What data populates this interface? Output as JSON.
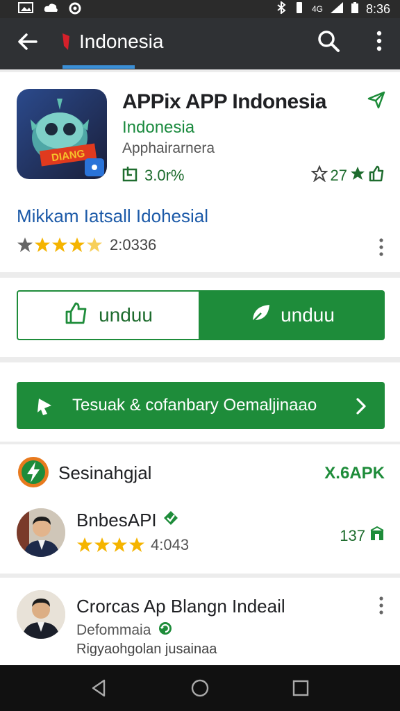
{
  "status_bar": {
    "time": "8:36",
    "carrier": "4G"
  },
  "app_bar": {
    "title": "Indonesia"
  },
  "app": {
    "name": "APPix APP Indonesia",
    "developer": "Indonesia",
    "category": "Apphairarnera",
    "downloads": "3.0r%",
    "rating_badge": "27",
    "icon_banner": "DIANG"
  },
  "promo": {
    "link": "Mikkam Iatsall Idohesial",
    "stars": 4,
    "count": "2:0336"
  },
  "buttons": {
    "outline_label": "unduu",
    "fill_label": "unduu"
  },
  "cta": {
    "label": "Tesuak & cofanbary Oemaljinaao"
  },
  "list": {
    "title": "Sesinahgjal",
    "tag": "X.6APK",
    "reviewer": {
      "name": "BnbesAPI",
      "stars": 4,
      "rating": "4:043",
      "count": "137"
    }
  },
  "dev": {
    "name": "Crorcas Ap Blangn Indeail",
    "sub": "Defommaia",
    "desc": "Rigyaohgolan jusainaa"
  },
  "colors": {
    "accent": "#1e8c3a",
    "link": "#1c5aa8",
    "topbar": "#2f3134",
    "star": "#f5b400"
  }
}
